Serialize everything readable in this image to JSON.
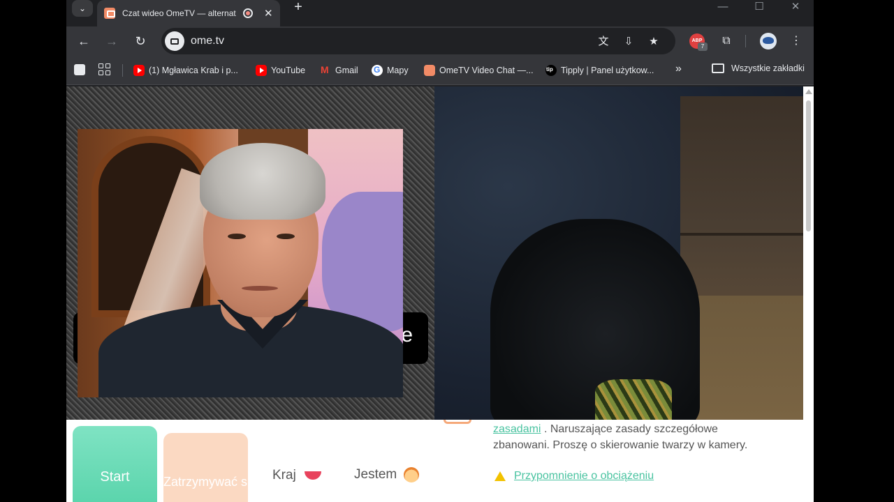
{
  "browser": {
    "tab_title": "Czat wideo OmeTV — alternat",
    "url": "ome.tv",
    "extension_badge": "ABP",
    "extension_count": "7"
  },
  "bookmarks": [
    {
      "label": "(1) Mgławica Krab i p...",
      "icon": "youtube-icon"
    },
    {
      "label": "YouTube",
      "icon": "youtube-icon"
    },
    {
      "label": "Gmail",
      "icon": "gmail-icon"
    },
    {
      "label": "Mapy",
      "icon": "google-icon"
    },
    {
      "label": "OmeTV Video Chat —...",
      "icon": "ometv-icon"
    },
    {
      "label": "Tipply | Panel użytkow...",
      "icon": "tipply-icon"
    }
  ],
  "bookmarks_more": "»",
  "all_bookmarks": "Wszystkie zakładki",
  "video": {
    "overlay_text": "e"
  },
  "controls": {
    "start_label": "Start",
    "stop_label": "Zatrzymywać się",
    "country_label": "Kraj",
    "gender_label": "Jestem"
  },
  "rules": {
    "link_text": "zasadami",
    "text": ". Naruszające zasady szczegółowe zbanowani. Proszę o skierowanie twarzy w kamery.",
    "reminder_link": "Przypomnienie o obciążeniu"
  },
  "colors": {
    "start_button": "#58d3aa",
    "stop_button": "#fbd9c2",
    "link": "#49c3a0"
  }
}
